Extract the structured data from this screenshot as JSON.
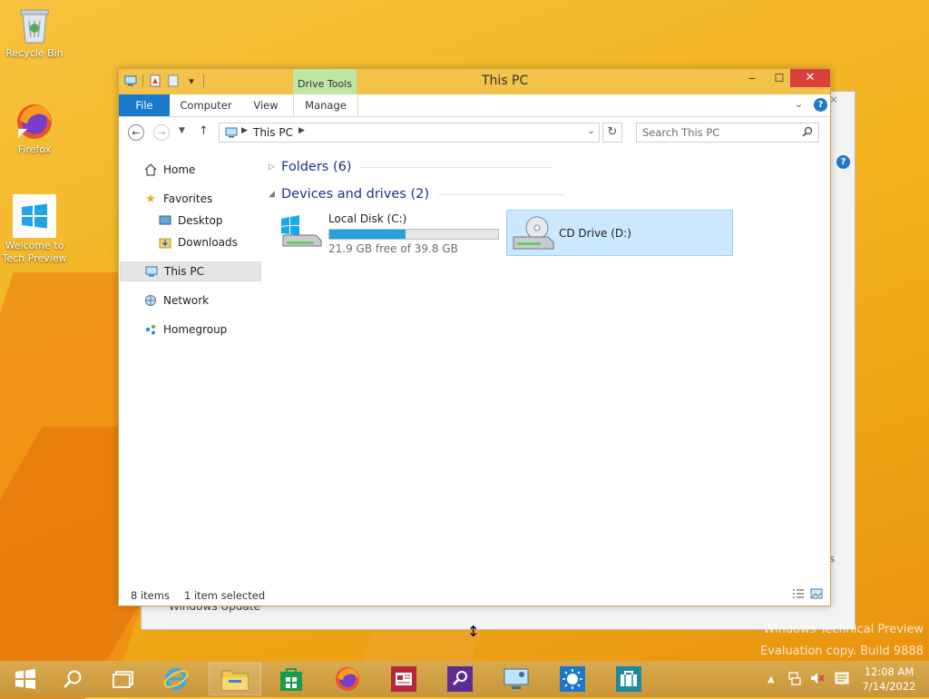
{
  "desktop": {
    "icons": [
      {
        "label": "Recycle Bin"
      },
      {
        "label": "Firefox"
      },
      {
        "label": "Welcome to Tech Preview"
      }
    ],
    "watermark": {
      "line1": "Windows Technical Preview",
      "line2": "Evaluation copy. Build 9888"
    }
  },
  "background_window": {
    "bottom_text": "Windows Update",
    "side_text": "s"
  },
  "window": {
    "title": "This PC",
    "contextual_tab_group": "Drive Tools",
    "tabs": {
      "file": "File",
      "computer": "Computer",
      "view": "View",
      "manage": "Manage"
    },
    "address": {
      "crumb": "This PC"
    },
    "search": {
      "placeholder": "Search This PC"
    },
    "nav": {
      "home": "Home",
      "favorites": "Favorites",
      "desktop": "Desktop",
      "downloads": "Downloads",
      "this_pc": "This PC",
      "network": "Network",
      "homegroup": "Homegroup"
    },
    "groups": {
      "folders": "Folders (6)",
      "devices": "Devices and drives (2)"
    },
    "drives": [
      {
        "name": "Local Disk (C:)",
        "free": "21.9 GB free of 39.8 GB",
        "used_fraction": 0.45
      },
      {
        "name": "CD Drive (D:)"
      }
    ],
    "status": {
      "items": "8 items",
      "selected": "1 item selected"
    }
  },
  "taskbar": {
    "clock_time": "12:08 AM",
    "clock_date": "7/14/2022",
    "accent": "#c8953a"
  }
}
